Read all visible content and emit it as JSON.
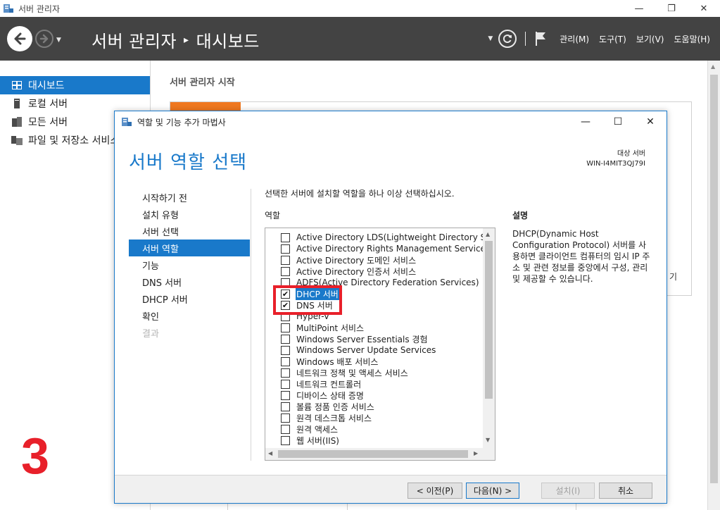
{
  "window": {
    "title": "서버 관리자",
    "minimize_glyph": "—",
    "restore_glyph": "❐",
    "close_glyph": "✕"
  },
  "header": {
    "breadcrumb_root": "서버 관리자",
    "breadcrumb_sep": "▸",
    "breadcrumb_current": "대시보드",
    "menus": [
      "관리(M)",
      "도구(T)",
      "보기(V)",
      "도움말(H)"
    ]
  },
  "sidebar": {
    "items": [
      {
        "label": "대시보드",
        "icon": "dashboard-icon",
        "active": true
      },
      {
        "label": "로컬 서버",
        "icon": "server-icon",
        "active": false
      },
      {
        "label": "모든 서버",
        "icon": "servers-icon",
        "active": false
      },
      {
        "label": "파일 및 저장소 서비스",
        "icon": "file-storage-icon",
        "active": false
      }
    ]
  },
  "main": {
    "heading": "서버 관리자 시작",
    "peek_text": "기"
  },
  "overlay_number": "3",
  "dialog": {
    "title": "역할 및 기능 추가 마법사",
    "heading": "서버 역할 선택",
    "dest_label": "대상 서버",
    "dest_server": "WIN-I4MIT3QJ79I",
    "steps": [
      {
        "label": "시작하기 전",
        "state": "normal"
      },
      {
        "label": "설치 유형",
        "state": "normal"
      },
      {
        "label": "서버 선택",
        "state": "normal"
      },
      {
        "label": "서버 역할",
        "state": "active"
      },
      {
        "label": "기능",
        "state": "normal"
      },
      {
        "label": "DNS 서버",
        "state": "normal"
      },
      {
        "label": "DHCP 서버",
        "state": "normal"
      },
      {
        "label": "확인",
        "state": "normal"
      },
      {
        "label": "결과",
        "state": "disabled"
      }
    ],
    "instruction": "선택한 서버에 설치할 역할을 하나 이상 선택하십시오.",
    "roles_label": "역할",
    "description_label": "설명",
    "description": "DHCP(Dynamic Host Configuration Protocol) 서버를 사용하면 클라이언트 컴퓨터의 임시 IP 주소 및 관련 정보를 중앙에서 구성, 관리 및 제공할 수 있습니다.",
    "roles": [
      {
        "label": "Active Directory LDS(Lightweight Directory Servic",
        "checked": false,
        "selected": false
      },
      {
        "label": "Active Directory Rights Management Services",
        "checked": false,
        "selected": false
      },
      {
        "label": "Active Directory 도메인 서비스",
        "checked": false,
        "selected": false
      },
      {
        "label": "Active Directory 인증서 서비스",
        "checked": false,
        "selected": false
      },
      {
        "label": "ADFS(Active Directory Federation Services)",
        "checked": false,
        "selected": false
      },
      {
        "label": "DHCP 서버",
        "checked": true,
        "selected": true
      },
      {
        "label": "DNS 서버",
        "checked": true,
        "selected": false
      },
      {
        "label": "Hyper-V",
        "checked": false,
        "selected": false
      },
      {
        "label": "MultiPoint 서비스",
        "checked": false,
        "selected": false
      },
      {
        "label": "Windows Server Essentials 경험",
        "checked": false,
        "selected": false
      },
      {
        "label": "Windows Server Update Services",
        "checked": false,
        "selected": false
      },
      {
        "label": "Windows 배포 서비스",
        "checked": false,
        "selected": false
      },
      {
        "label": "네트워크 정책 및 액세스 서비스",
        "checked": false,
        "selected": false
      },
      {
        "label": "네트워크 컨트롤러",
        "checked": false,
        "selected": false
      },
      {
        "label": "디바이스 상태 증명",
        "checked": false,
        "selected": false
      },
      {
        "label": "볼륨 정품 인증 서비스",
        "checked": false,
        "selected": false
      },
      {
        "label": "원격 데스크톱 서비스",
        "checked": false,
        "selected": false
      },
      {
        "label": "원격 액세스",
        "checked": false,
        "selected": false
      },
      {
        "label": "웹 서버(IIS)",
        "checked": false,
        "selected": false
      }
    ],
    "buttons": {
      "prev": "< 이전(P)",
      "next": "다음(N) >",
      "install": "설치(I)",
      "cancel": "취소"
    }
  }
}
